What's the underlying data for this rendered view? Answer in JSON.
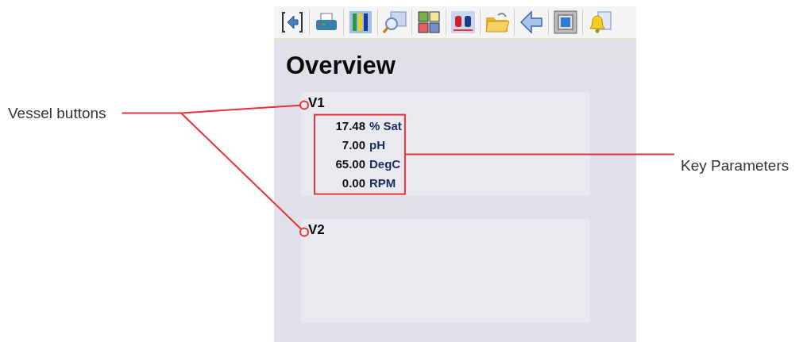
{
  "annotations": [
    {
      "kind": "vessels",
      "label": "Vessel buttons"
    },
    {
      "kind": "parameters",
      "label": "Key Parameters"
    }
  ],
  "screen": {
    "title": "Overview",
    "vessels": [
      {
        "label": "V1",
        "parameters": [
          {
            "value": "17.48",
            "unit": "% Sat"
          },
          {
            "value": "7.00",
            "unit": "pH"
          },
          {
            "value": "65.00",
            "unit": "DegC"
          },
          {
            "value": "0.00",
            "unit": "RPM"
          }
        ]
      },
      {
        "label": "V2"
      }
    ]
  }
}
